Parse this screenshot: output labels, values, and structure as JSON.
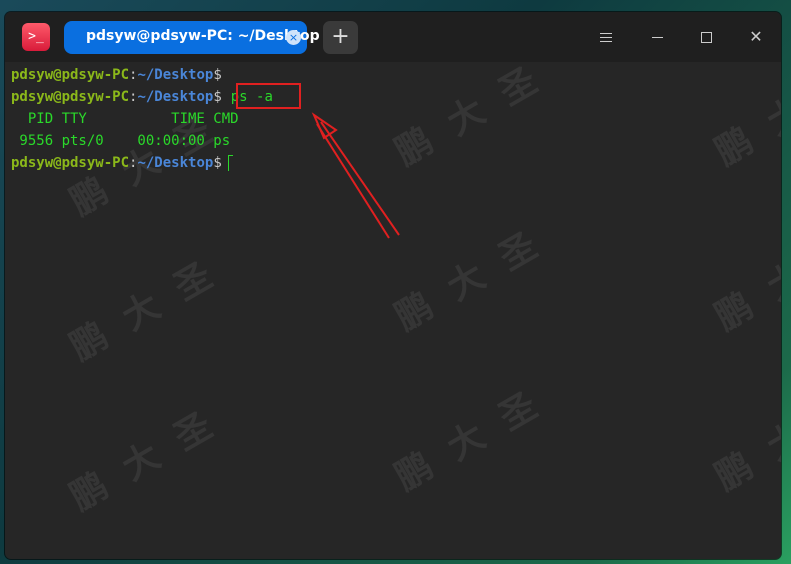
{
  "app_icon_glyph": ">_",
  "tab": {
    "title": "pdsyw@pdsyw-PC: ~/Desktop",
    "close_glyph": "×"
  },
  "new_tab_glyph": "+",
  "window_controls": {
    "close_glyph": "✕"
  },
  "prompt": {
    "user_host": "pdsyw@pdsyw-PC",
    "colon": ":",
    "path": "~/Desktop",
    "symbol": "$"
  },
  "terminal": {
    "command": "ps -a",
    "output_header": "  PID TTY          TIME CMD",
    "output_row": " 9556 pts/0    00:00:00 ps"
  },
  "watermark_text": "鹏大圣",
  "colors": {
    "tab_active": "#0a6fe0",
    "prompt_user": "#8bb81a",
    "prompt_path": "#4a86d8",
    "output": "#2ad92a",
    "annotation": "#e02020"
  }
}
